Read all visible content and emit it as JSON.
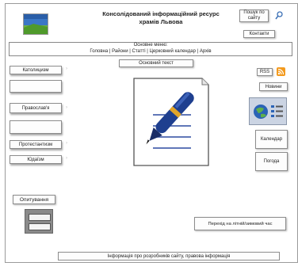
{
  "header": {
    "title_line1": "Консолідований інформаційний ресурс",
    "title_line2": "храмів Львова",
    "search_label": "Пошук по сайту",
    "contacts_label": "Контакти"
  },
  "menu": {
    "heading": "Основне меню:",
    "items": [
      "Головна",
      "Райони",
      "Статті",
      "Церковний календар",
      "Архів"
    ]
  },
  "sidebar": {
    "catholicism": "Католицизм",
    "orthodoxy": "Православ'я",
    "protestantism": "Протестантизм",
    "judaism": "Юдаїзм"
  },
  "main": {
    "content_label": "Основний текст"
  },
  "right": {
    "rss_label": "RSS",
    "news_label": "Новини",
    "calendar_label": "Календар",
    "weather_label": "Погода"
  },
  "poll": {
    "label": "Опитування"
  },
  "time_switch": {
    "label": "Перехід на літній/зимовий час"
  },
  "footer": {
    "label": "Інформація про розробників сайту, правова інформація"
  },
  "colors": {
    "pen_blue": "#1e3f8f",
    "pen_gold": "#e1a52a",
    "rss_orange": "#f39a1e",
    "search_icon_blue": "#3a6fb5"
  }
}
